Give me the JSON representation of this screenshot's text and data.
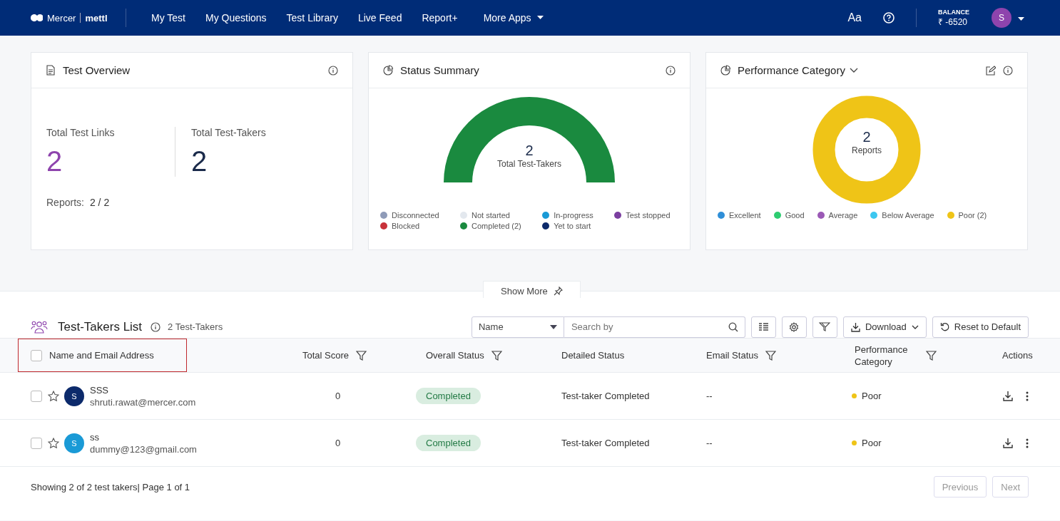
{
  "header": {
    "logo": {
      "brand": "Mercer",
      "product": "mettl"
    },
    "nav": [
      {
        "label": "My Test",
        "dropdown": false
      },
      {
        "label": "My Questions",
        "dropdown": false
      },
      {
        "label": "Test Library",
        "dropdown": false
      },
      {
        "label": "Live Feed",
        "dropdown": false
      },
      {
        "label": "Report+",
        "dropdown": false
      },
      {
        "label": "More Apps",
        "dropdown": true
      }
    ],
    "font_button": "Aa",
    "balance": {
      "label": "BALANCE",
      "value": "₹ -6520"
    },
    "avatar": "S"
  },
  "test_overview": {
    "title": "Test Overview",
    "stats": [
      {
        "label": "Total Test Links",
        "value": "2",
        "kind": "accent"
      },
      {
        "label": "Total Test-Takers",
        "value": "2",
        "kind": "plain"
      }
    ],
    "reports_label": "Reports:",
    "reports_value": "2 / 2"
  },
  "status_summary": {
    "title": "Status Summary",
    "center_value": "2",
    "center_label": "Total Test-Takers",
    "legend": [
      {
        "label": "Disconnected",
        "color": "#8f9bb8"
      },
      {
        "label": "Not started",
        "color": "#e3e8ee"
      },
      {
        "label": "In-progress",
        "color": "#1a9ad6"
      },
      {
        "label": "Test stopped",
        "color": "#7b3fa0"
      },
      {
        "label": "Blocked",
        "color": "#c8323a"
      },
      {
        "label": "Completed (2)",
        "color": "#1a8a3f"
      },
      {
        "label": "Yet to start",
        "color": "#0c2a6b"
      }
    ]
  },
  "performance_category": {
    "title": "Performance Category",
    "center_value": "2",
    "center_label": "Reports",
    "legend": [
      {
        "label": "Excellent",
        "color": "#2f8fd8"
      },
      {
        "label": "Good",
        "color": "#2ecc71"
      },
      {
        "label": "Average",
        "color": "#9b59b6"
      },
      {
        "label": "Below Average",
        "color": "#3cc7f0"
      },
      {
        "label": "Poor (2)",
        "color": "#efc417"
      }
    ]
  },
  "show_more": "Show More",
  "takers_list": {
    "title": "Test-Takers List",
    "count": "2 Test-Takers",
    "search": {
      "field": "Name",
      "placeholder": "Search by"
    },
    "download": "Download",
    "reset": "Reset to Default"
  },
  "table": {
    "select_all": {
      "checked": false
    },
    "columns": [
      {
        "label": "Name and Email Address",
        "filter": false,
        "highlighted": true
      },
      {
        "label": "Total Score",
        "filter": true,
        "highlighted": false
      },
      {
        "label": "Overall Status",
        "filter": true,
        "highlighted": false
      },
      {
        "label": "Detailed Status",
        "filter": false,
        "highlighted": false
      },
      {
        "label": "Email Status",
        "filter": true,
        "highlighted": false
      },
      {
        "label": "Performance Category",
        "filter": true,
        "highlighted": false
      },
      {
        "label": "Actions",
        "filter": false,
        "highlighted": false
      }
    ],
    "rows": [
      {
        "checked": false,
        "starred": false,
        "avatar": {
          "initial": "S",
          "color": "#0c2a6b"
        },
        "name": "SSS",
        "email": "shruti.rawat@mercer.com",
        "score": "0",
        "overall_status": "Completed",
        "detailed_status": "Test-taker Completed",
        "email_status": "--",
        "performance": {
          "label": "Poor",
          "color": "#efc417"
        }
      },
      {
        "checked": false,
        "starred": false,
        "avatar": {
          "initial": "S",
          "color": "#1a9ad6"
        },
        "name": "ss",
        "email": "dummy@123@gmail.com",
        "score": "0",
        "overall_status": "Completed",
        "detailed_status": "Test-taker Completed",
        "email_status": "--",
        "performance": {
          "label": "Poor",
          "color": "#efc417"
        }
      }
    ]
  },
  "footer": {
    "summary": "Showing 2 of 2 test takers| Page 1 of 1",
    "pagination": [
      {
        "label": "Previous",
        "disabled": true
      },
      {
        "label": "Next",
        "disabled": true
      }
    ]
  }
}
